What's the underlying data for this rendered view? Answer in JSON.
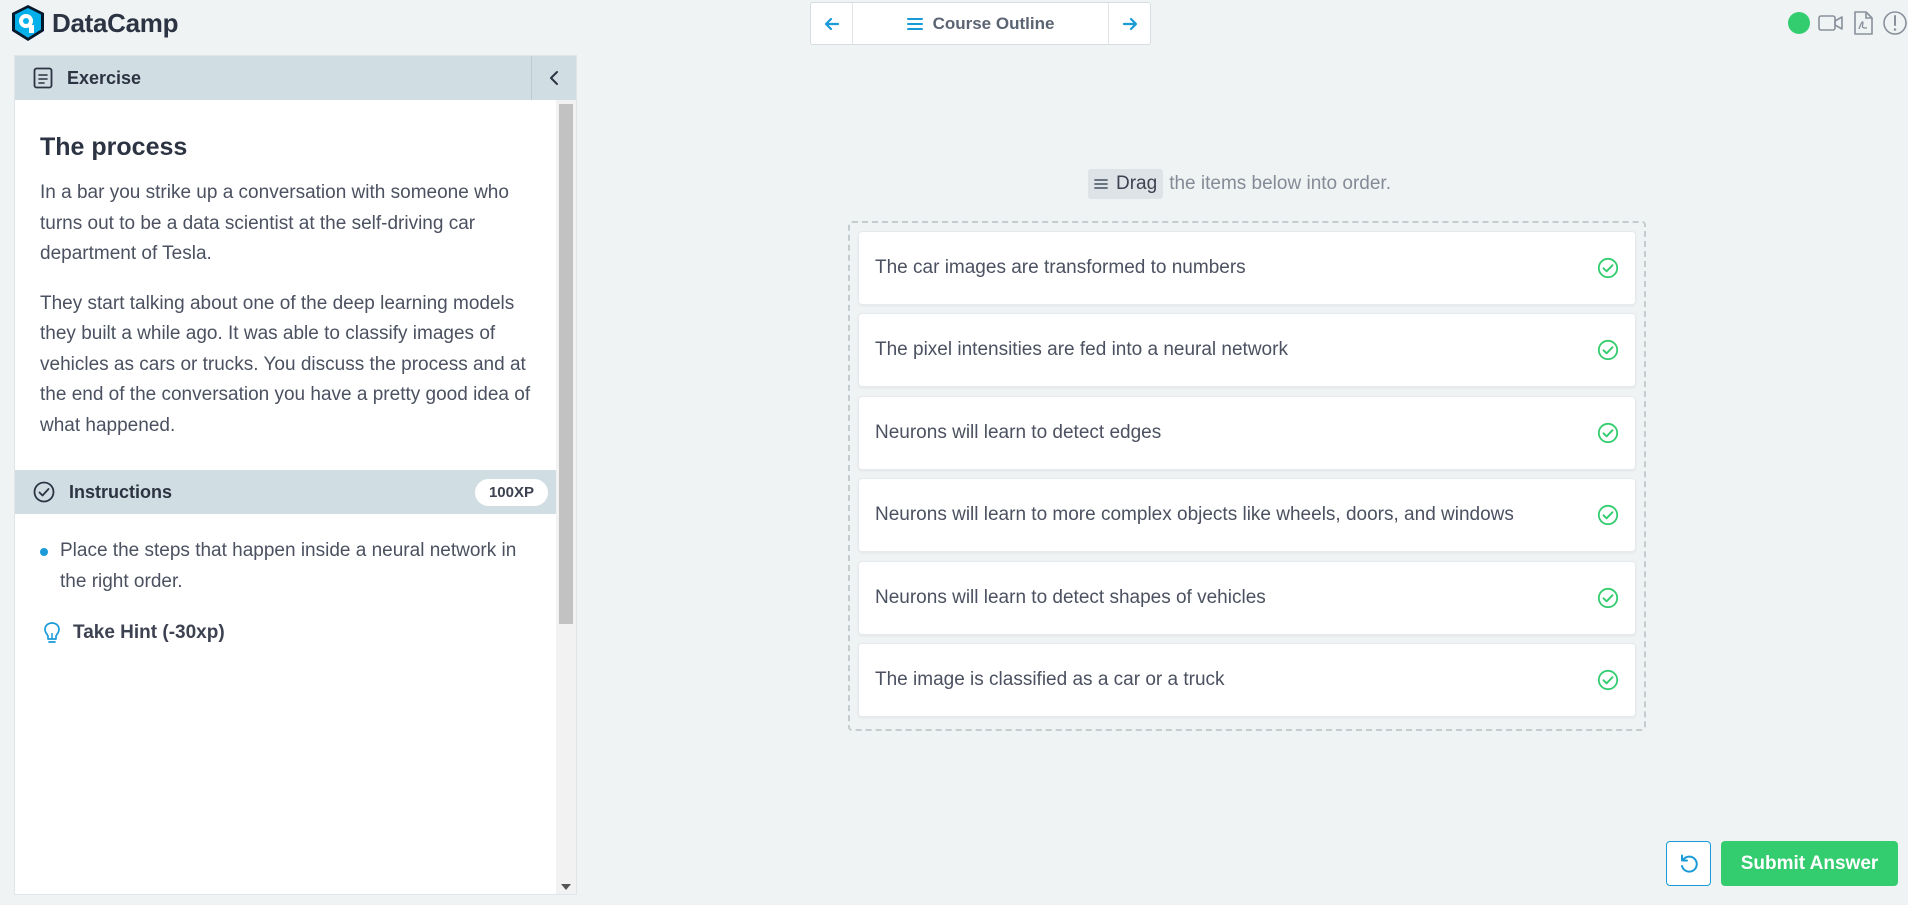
{
  "app": {
    "name": "DataCamp"
  },
  "nav": {
    "center_label": "Course Outline"
  },
  "exercise_panel": {
    "header_label": "Exercise",
    "title": "The process",
    "paragraphs": [
      "In a bar you strike up a conversation with someone who turns out to be a data scientist at the self-driving car department of Tesla.",
      "They start talking about one of the deep learning models they built a while ago. It was able to classify images of vehicles as cars or trucks. You discuss the process and at the end of the conversation you have a pretty good idea of what happened."
    ],
    "instructions_label": "Instructions",
    "xp_badge": "100XP",
    "instructions": [
      "Place the steps that happen inside a neural network in the right order."
    ],
    "hint_label": "Take Hint (-30xp)"
  },
  "drag": {
    "chip_label": "Drag",
    "rest_label": "the items below into order.",
    "items": [
      "The car images are transformed to numbers",
      "The pixel intensities are fed into a neural network",
      "Neurons will learn to detect edges",
      "Neurons will learn to more complex objects like wheels, doors, and windows",
      "Neurons will learn to detect shapes of vehicles",
      "The image is classified as a car or a truck"
    ]
  },
  "actions": {
    "submit_label": "Submit Answer"
  },
  "colors": {
    "accent": "#1a9bd8",
    "success": "#33cc6e",
    "panel_header": "#d0dde3"
  },
  "icons": [
    "logo-icon",
    "arrow-left-icon",
    "menu-icon",
    "arrow-right-icon",
    "status-dot",
    "video-icon",
    "pdf-icon",
    "alert-icon",
    "document-icon",
    "chevron-left-icon",
    "check-circle-icon",
    "lightbulb-icon",
    "drag-handle-icon",
    "check-icon",
    "undo-icon"
  ]
}
